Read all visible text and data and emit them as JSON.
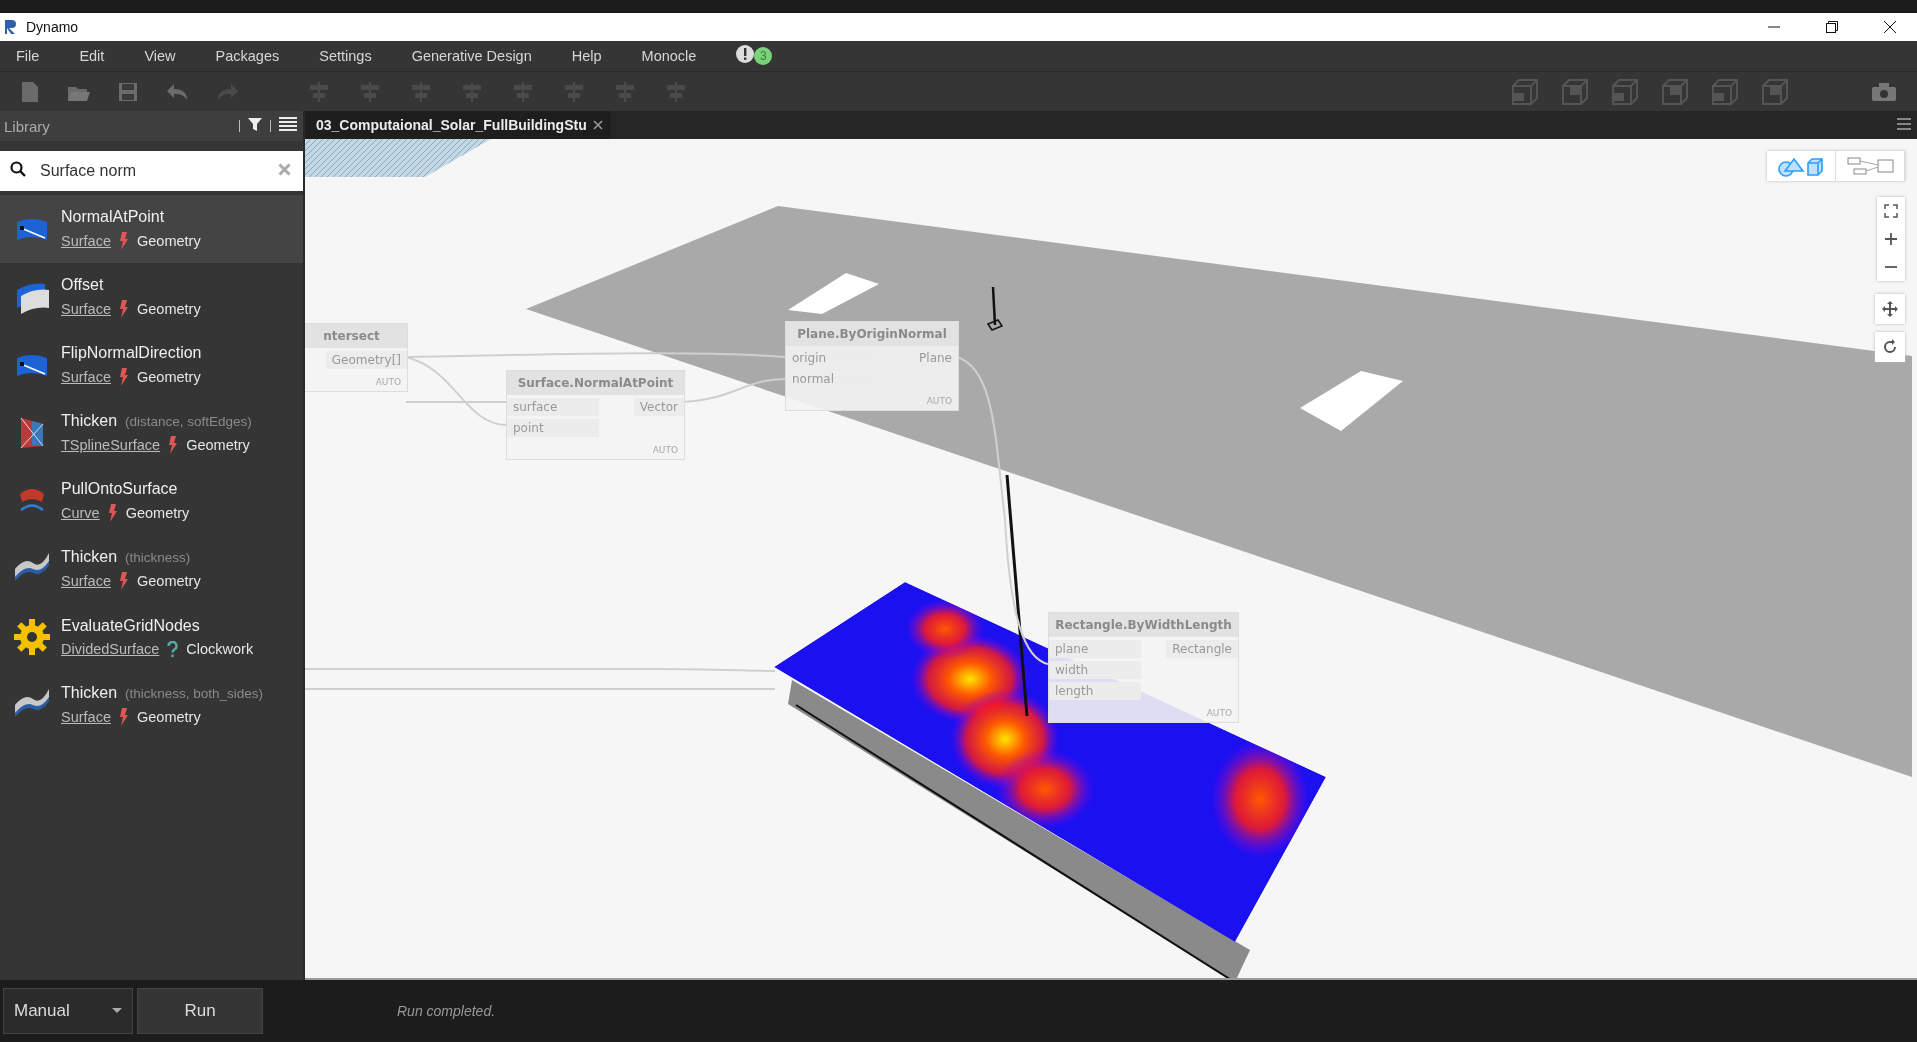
{
  "window": {
    "title": "Dynamo"
  },
  "menu": [
    "File",
    "Edit",
    "View",
    "Packages",
    "Settings",
    "Generative Design",
    "Help",
    "Monocle"
  ],
  "notifications": {
    "count": "3"
  },
  "library": {
    "title": "Library",
    "search": {
      "value": "Surface norm"
    },
    "results": [
      {
        "name": "NormalAtPoint",
        "category": "Surface",
        "source": "Geometry",
        "kind": "surface",
        "builtin": true,
        "selected": true
      },
      {
        "name": "Offset",
        "category": "Surface",
        "source": "Geometry",
        "kind": "offset",
        "builtin": true,
        "selected": false
      },
      {
        "name": "FlipNormalDirection",
        "category": "Surface",
        "source": "Geometry",
        "kind": "surface",
        "builtin": true,
        "selected": false
      },
      {
        "name": "Thicken",
        "params": "(distance, softEdges)",
        "category": "TSplineSurface",
        "source": "Geometry",
        "kind": "tspline",
        "builtin": true,
        "selected": false
      },
      {
        "name": "PullOntoSurface",
        "category": "Curve",
        "source": "Geometry",
        "kind": "curve",
        "builtin": true,
        "selected": false
      },
      {
        "name": "Thicken",
        "params": "(thickness)",
        "category": "Surface",
        "source": "Geometry",
        "kind": "solid",
        "builtin": true,
        "selected": false
      },
      {
        "name": "EvaluateGridNodes",
        "category": "DividedSurface",
        "source": "Clockwork",
        "kind": "package",
        "builtin": false,
        "selected": false
      },
      {
        "name": "Thicken",
        "params": "(thickness, both_sides)",
        "category": "Surface",
        "source": "Geometry",
        "kind": "solid",
        "builtin": true,
        "selected": false
      }
    ]
  },
  "tab": {
    "label": "03_Computaional_Solar_FullBuildingStu",
    "selected": true
  },
  "graph_nodes": [
    {
      "title": "ntersect",
      "outputs": [
        "Geometry[]"
      ],
      "lacing": "AUTO"
    },
    {
      "title": "Surface.NormalAtPoint",
      "inputs": [
        "surface",
        "point"
      ],
      "outputs": [
        "Vector"
      ],
      "lacing": "AUTO"
    },
    {
      "title": "Plane.ByOriginNormal",
      "inputs": [
        "origin",
        "normal"
      ],
      "outputs": [
        "Plane"
      ],
      "lacing": "AUTO"
    },
    {
      "title": "Rectangle.ByWidthLength",
      "inputs": [
        "plane",
        "width",
        "length"
      ],
      "outputs": [
        "Rectangle"
      ],
      "lacing": "AUTO"
    }
  ],
  "run": {
    "mode": "Manual",
    "button": "Run",
    "status": "Run completed."
  }
}
